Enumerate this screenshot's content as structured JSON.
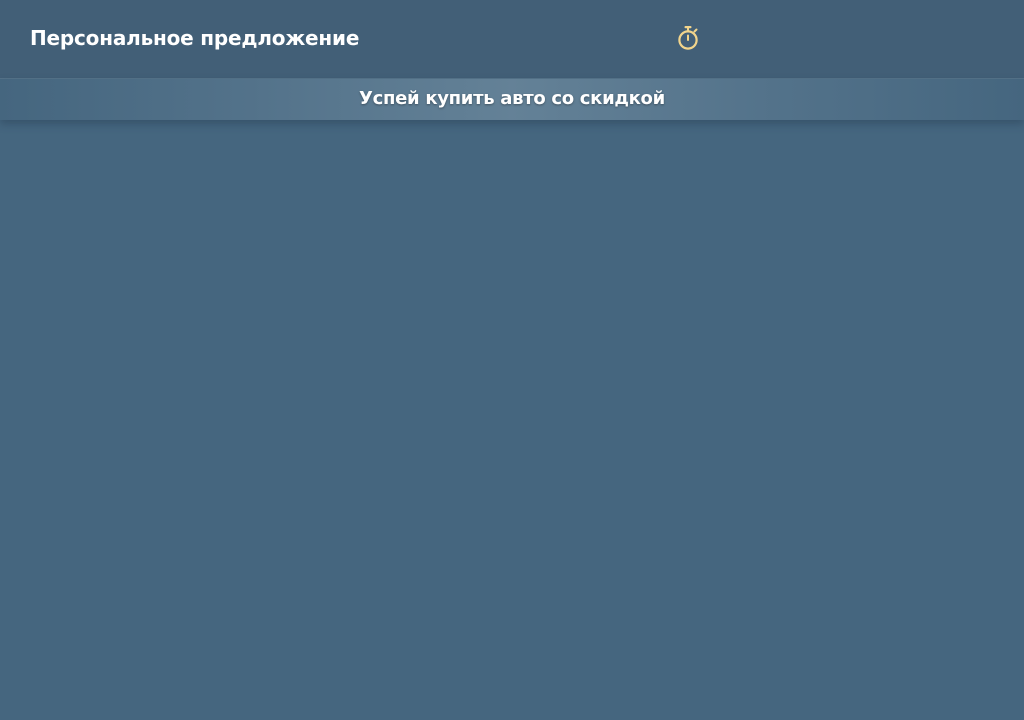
{
  "header": {
    "title": "Персональное предложение",
    "timer_icon": "stopwatch-icon",
    "timer_icon_color": "#f2d58c"
  },
  "banner": {
    "text": "Успей купить авто со скидкой"
  },
  "colors": {
    "background": "#45667f",
    "header_background": "#425f77"
  }
}
